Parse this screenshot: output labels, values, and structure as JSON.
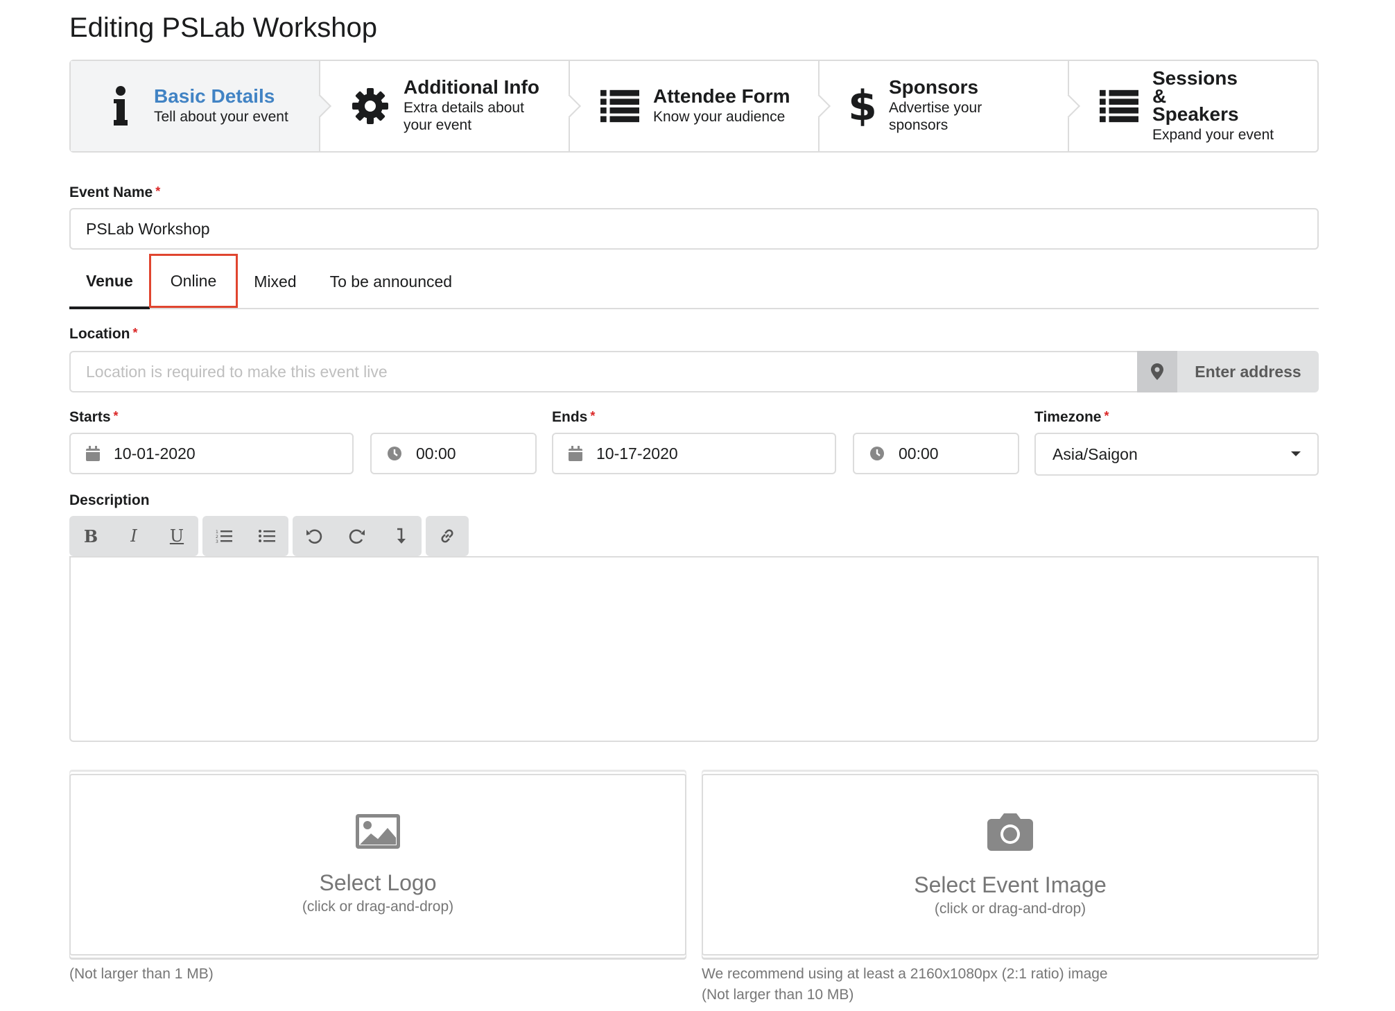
{
  "page": {
    "title": "Editing PSLab Workshop"
  },
  "steps": [
    {
      "title": "Basic Details",
      "desc": "Tell about your event",
      "icon": "info-icon",
      "active": true
    },
    {
      "title": "Additional Info",
      "desc": "Extra details about your event",
      "icon": "gear-icon"
    },
    {
      "title": "Attendee Form",
      "desc": "Know your audience",
      "icon": "list-icon"
    },
    {
      "title": "Sponsors",
      "desc": "Advertise your sponsors",
      "icon": "dollar-icon"
    },
    {
      "title": "Sessions & Speakers",
      "desc": "Expand your event",
      "icon": "list-icon"
    }
  ],
  "event_name": {
    "label": "Event Name",
    "value": "PSLab Workshop",
    "required": "*"
  },
  "tabs": [
    {
      "label": "Venue",
      "active": true
    },
    {
      "label": "Online",
      "highlighted": true
    },
    {
      "label": "Mixed"
    },
    {
      "label": "To be announced"
    }
  ],
  "location": {
    "label": "Location",
    "placeholder": "Location is required to make this event live",
    "button": "Enter address",
    "required": "*"
  },
  "starts": {
    "label": "Starts",
    "date": "10-01-2020",
    "time": "00:00",
    "required": "*"
  },
  "ends": {
    "label": "Ends",
    "date": "10-17-2020",
    "time": "00:00",
    "required": "*"
  },
  "timezone": {
    "label": "Timezone",
    "value": "Asia/Saigon",
    "required": "*"
  },
  "description": {
    "label": "Description",
    "toolbar": [
      "bold-icon",
      "italic-icon",
      "underline-icon",
      "ordered-list-icon",
      "unordered-list-icon",
      "undo-icon",
      "redo-icon",
      "line-break-icon",
      "link-icon"
    ]
  },
  "logo_upload": {
    "title": "Select Logo",
    "sub": "(click or drag-and-drop)",
    "note": "(Not larger than 1 MB)"
  },
  "image_upload": {
    "title": "Select Event Image",
    "sub": "(click or drag-and-drop)",
    "note_1": "We recommend using at least a 2160x1080px (2:1 ratio) image",
    "note_2": "(Not larger than 10 MB)"
  },
  "colors": {
    "accent": "#4183c4",
    "required": "#db2828",
    "highlight": "#e0452f",
    "border": "#dcdcdc"
  }
}
